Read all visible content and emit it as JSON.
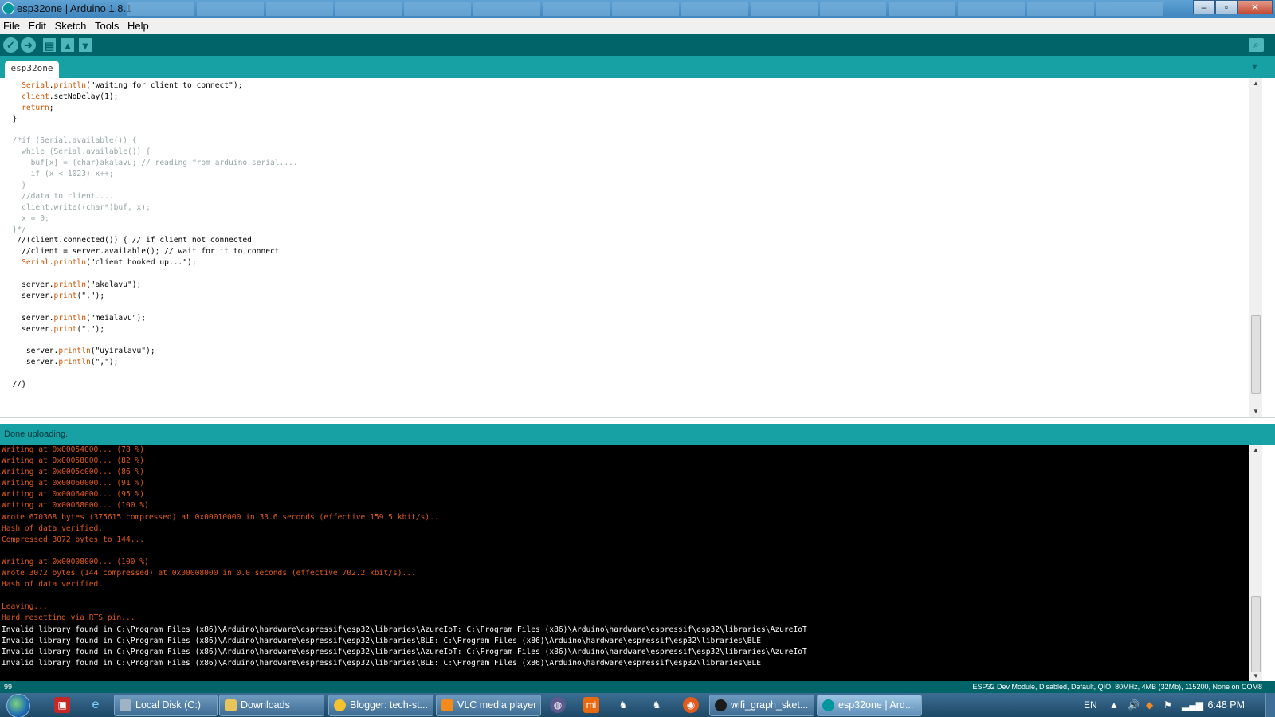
{
  "window": {
    "title": "esp32one | Arduino 1.8.1"
  },
  "menu": [
    "File",
    "Edit",
    "Sketch",
    "Tools",
    "Help"
  ],
  "toolbar": {
    "verify": "✓",
    "upload": "➜"
  },
  "tabs": [
    {
      "label": "esp32one"
    }
  ],
  "editor": {
    "lines": [
      [
        [
          "    ",
          ""
        ],
        [
          "Serial",
          "kw"
        ],
        [
          ".",
          ""
        ],
        [
          "println",
          "kw"
        ],
        [
          "(\"waiting for client to connect\");",
          ""
        ]
      ],
      [
        [
          "    ",
          ""
        ],
        [
          "client",
          "kw"
        ],
        [
          ".setNoDelay(1);",
          ""
        ]
      ],
      [
        [
          "    ",
          ""
        ],
        [
          "return",
          "kw"
        ],
        [
          ";",
          ""
        ]
      ],
      [
        [
          "  }",
          ""
        ]
      ],
      [
        [
          "",
          ""
        ]
      ],
      [
        [
          "  /*if (Serial.available()) {",
          "c"
        ]
      ],
      [
        [
          "    while (Serial.available()) {",
          "c"
        ]
      ],
      [
        [
          "      buf[x] = (char)akalavu; // reading from arduino serial....",
          "c"
        ]
      ],
      [
        [
          "      if (x < 1023) x++;",
          "c"
        ]
      ],
      [
        [
          "    }",
          "c"
        ]
      ],
      [
        [
          "    //data to client.....",
          "c"
        ]
      ],
      [
        [
          "    client.write((char*)buf, x);",
          "c"
        ]
      ],
      [
        [
          "    x = 0;",
          "c"
        ]
      ],
      [
        [
          "  }*/",
          "c"
        ]
      ],
      [
        [
          "   //(client.connected()) { // if client not connected",
          ""
        ]
      ],
      [
        [
          "    //client = server.available(); // wait for it to connect",
          ""
        ]
      ],
      [
        [
          "    ",
          ""
        ],
        [
          "Serial",
          "kw"
        ],
        [
          ".",
          ""
        ],
        [
          "println",
          "kw"
        ],
        [
          "(\"client hooked up...\");",
          ""
        ]
      ],
      [
        [
          "",
          ""
        ]
      ],
      [
        [
          "    server.",
          ""
        ],
        [
          "println",
          "kw"
        ],
        [
          "(\"akalavu\");",
          ""
        ]
      ],
      [
        [
          "    server.",
          ""
        ],
        [
          "print",
          "kw"
        ],
        [
          "(\",\");",
          ""
        ]
      ],
      [
        [
          "",
          ""
        ]
      ],
      [
        [
          "    server.",
          ""
        ],
        [
          "println",
          "kw"
        ],
        [
          "(\"meialavu\");",
          ""
        ]
      ],
      [
        [
          "    server.",
          ""
        ],
        [
          "print",
          "kw"
        ],
        [
          "(\",\");",
          ""
        ]
      ],
      [
        [
          "",
          ""
        ]
      ],
      [
        [
          "     server.",
          ""
        ],
        [
          "println",
          "kw"
        ],
        [
          "(\"uyiralavu\");",
          ""
        ]
      ],
      [
        [
          "     server.",
          ""
        ],
        [
          "println",
          "kw"
        ],
        [
          "(\",\");",
          ""
        ]
      ],
      [
        [
          "",
          ""
        ]
      ],
      [
        [
          "  //}",
          ""
        ]
      ]
    ]
  },
  "status": {
    "message": "Done uploading."
  },
  "console": {
    "lines": [
      {
        "text": "Writing at 0x00054000... (78 %)",
        "color": "orange"
      },
      {
        "text": "Writing at 0x00058000... (82 %)",
        "color": "orange"
      },
      {
        "text": "Writing at 0x0005c000... (86 %)",
        "color": "orange"
      },
      {
        "text": "Writing at 0x00060000... (91 %)",
        "color": "orange"
      },
      {
        "text": "Writing at 0x00064000... (95 %)",
        "color": "orange"
      },
      {
        "text": "Writing at 0x00068000... (100 %)",
        "color": "orange"
      },
      {
        "text": "Wrote 670368 bytes (375615 compressed) at 0x00010000 in 33.6 seconds (effective 159.5 kbit/s)...",
        "color": "orange"
      },
      {
        "text": "Hash of data verified.",
        "color": "orange"
      },
      {
        "text": "Compressed 3072 bytes to 144...",
        "color": "orange"
      },
      {
        "text": "",
        "color": "orange"
      },
      {
        "text": "Writing at 0x00008000... (100 %)",
        "color": "orange"
      },
      {
        "text": "Wrote 3072 bytes (144 compressed) at 0x00008000 in 0.0 seconds (effective 702.2 kbit/s)...",
        "color": "orange"
      },
      {
        "text": "Hash of data verified.",
        "color": "orange"
      },
      {
        "text": "",
        "color": "orange"
      },
      {
        "text": "Leaving...",
        "color": "orange"
      },
      {
        "text": "Hard resetting via RTS pin...",
        "color": "orange"
      },
      {
        "text": "Invalid library found in C:\\Program Files (x86)\\Arduino\\hardware\\espressif\\esp32\\libraries\\AzureIoT: C:\\Program Files (x86)\\Arduino\\hardware\\espressif\\esp32\\libraries\\AzureIoT",
        "color": "white"
      },
      {
        "text": "Invalid library found in C:\\Program Files (x86)\\Arduino\\hardware\\espressif\\esp32\\libraries\\BLE: C:\\Program Files (x86)\\Arduino\\hardware\\espressif\\esp32\\libraries\\BLE",
        "color": "white"
      },
      {
        "text": "Invalid library found in C:\\Program Files (x86)\\Arduino\\hardware\\espressif\\esp32\\libraries\\AzureIoT: C:\\Program Files (x86)\\Arduino\\hardware\\espressif\\esp32\\libraries\\AzureIoT",
        "color": "white"
      },
      {
        "text": "Invalid library found in C:\\Program Files (x86)\\Arduino\\hardware\\espressif\\esp32\\libraries\\BLE: C:\\Program Files (x86)\\Arduino\\hardware\\espressif\\esp32\\libraries\\BLE",
        "color": "white"
      }
    ]
  },
  "boardbar": {
    "line_number": "99",
    "board_info": "ESP32 Dev Module, Disabled, Default, QIO, 80MHz, 4MB (32Mb), 115200, None on COM8"
  },
  "taskbar": {
    "windows": [
      {
        "label": "Local Disk (C:)",
        "icon": "drive-icon"
      },
      {
        "label": "Downloads",
        "icon": "folder-icon"
      },
      {
        "label": "Blogger: tech-st...",
        "icon": "chrome-icon"
      },
      {
        "label": "VLC media player",
        "icon": "vlc-icon"
      },
      {
        "label": "wifi_graph_sket...",
        "icon": "arduino-icon"
      },
      {
        "label": "esp32one | Ard...",
        "icon": "arduino-icon",
        "active": true
      }
    ],
    "language": "EN",
    "clock": "6:48 PM"
  },
  "colors": {
    "arduino_dark": "#006468",
    "arduino_teal": "#17a1a5",
    "keyword": "#d35400",
    "comment": "#95a5a6",
    "console_orange": "#e05a1b"
  }
}
